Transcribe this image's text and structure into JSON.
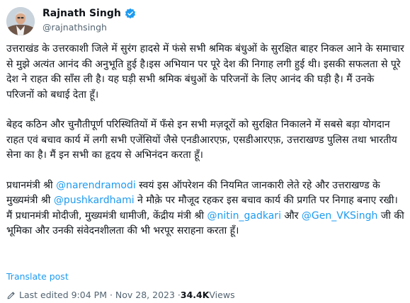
{
  "author": {
    "name": "Rajnath Singh",
    "handle": "@rajnathsingh"
  },
  "tweet": {
    "paragraphs": [
      [
        {
          "text": "उत्तराखंड के उत्तरकाशी जिले में सुरंग हादसे में फंसे सभी श्रमिक बंधुओं के सुरक्षित बाहर निकल आने के समाचार से मुझे अत्यंत आनंद की अनुभूति हुई है।इस अभियान पर पूरे देश की निगाह लगी हुई थी। इसकी सफलता से पूरे देश ने राहत की साँस ली है। यह घड़ी सभी श्रमिक बंधुओं के परिजनों के लिए आनंद की घड़ी है। मैं उनके परिजनों को बधाई देता हूँ।",
          "mention": false
        }
      ],
      [
        {
          "text": "बेहद कठिन और चुनौतीपूर्ण परिस्थितियों में फँसे इन सभी मज़दूरों को सुरक्षित निकालने में सबसे बड़ा योगदान राहत एवं बचाव कार्य में लगी सभी एजेंसियों जैसे एनडीआरएफ़, एसडीआरएफ़, उत्तराखण्ड पुलिस तथा भारतीय सेना का है। मैं इन सभी का हृदय से अभिनंदन करता हूँ।",
          "mention": false
        }
      ],
      [
        {
          "text": "प्रधानमंत्री श्री ",
          "mention": false
        },
        {
          "text": "@narendramodi",
          "mention": true
        },
        {
          "text": " स्वयं इस ऑपरेशन की नियमित जानकारी लेते रहे और उत्तराखण्ड के मुख्यमंत्री श्री ",
          "mention": false
        },
        {
          "text": "@pushkardhami",
          "mention": true
        },
        {
          "text": " ने मौक़े पर मौजूद रहकर इस बचाव कार्य की प्रगति पर निगाह बनाए रखी। मैं प्रधानमंत्री मोदीजी, मुख्यमंत्री धामीजी, केंद्रीय मंत्री श्री ",
          "mention": false
        },
        {
          "text": "@nitin_gadkari",
          "mention": true
        },
        {
          "text": " और ",
          "mention": false
        },
        {
          "text": "@Gen_VKSingh",
          "mention": true
        },
        {
          "text": " जी की भूमिका और उनकी संवेदनशीलता की भी भरपूर सराहना करता हूँ।",
          "mention": false
        }
      ]
    ],
    "translate_label": "Translate post",
    "last_edited": "Last edited 9:04 PM · Nov 28, 2023 · ",
    "views_count": "34.4K",
    "views_label": " Views"
  },
  "colors": {
    "link": "#1d9bf0",
    "text": "#0f1419",
    "secondary": "#536471",
    "verified": "#1d9bf0"
  },
  "icons": {
    "verified": "verified-badge-icon",
    "edit": "pencil-edit-icon"
  }
}
